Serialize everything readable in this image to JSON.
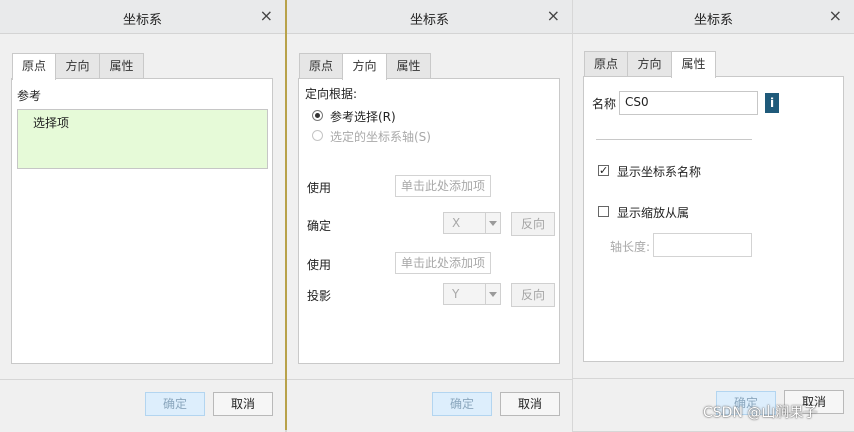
{
  "dialogs": [
    {
      "title": "坐标系",
      "tabs": [
        "原点",
        "方向",
        "属性"
      ],
      "reference_label": "参考",
      "selection_item": "选择项",
      "ok": "确定",
      "cancel": "取消"
    },
    {
      "title": "坐标系",
      "tabs": [
        "原点",
        "方向",
        "属性"
      ],
      "orient_by": "定向根据:",
      "radio_ref": "参考选择(R)",
      "radio_axis": "选定的坐标系轴(S)",
      "use1": "使用",
      "placeholder1": "单击此处添加项",
      "determine": "确定",
      "axis1": "X",
      "flip1": "反向",
      "use2": "使用",
      "placeholder2": "单击此处添加项",
      "project": "投影",
      "axis2": "Y",
      "flip2": "反向",
      "ok": "确定",
      "cancel": "取消"
    },
    {
      "title": "坐标系",
      "tabs": [
        "原点",
        "方向",
        "属性"
      ],
      "name_label": "名称",
      "name_value": "CS0",
      "show_name": "显示坐标系名称",
      "show_scale": "显示缩放从属",
      "axis_length": "轴长度:",
      "axis_length_value": "",
      "ok": "确定",
      "cancel": "取消"
    }
  ],
  "close_glyph": "×",
  "info_glyph": "i",
  "watermark": "CSDN @山涧果子",
  "colors": {
    "selection_bg": "#e6fad8",
    "info_icon": "#1f5a7a",
    "ok_button": "#ddeefc"
  }
}
